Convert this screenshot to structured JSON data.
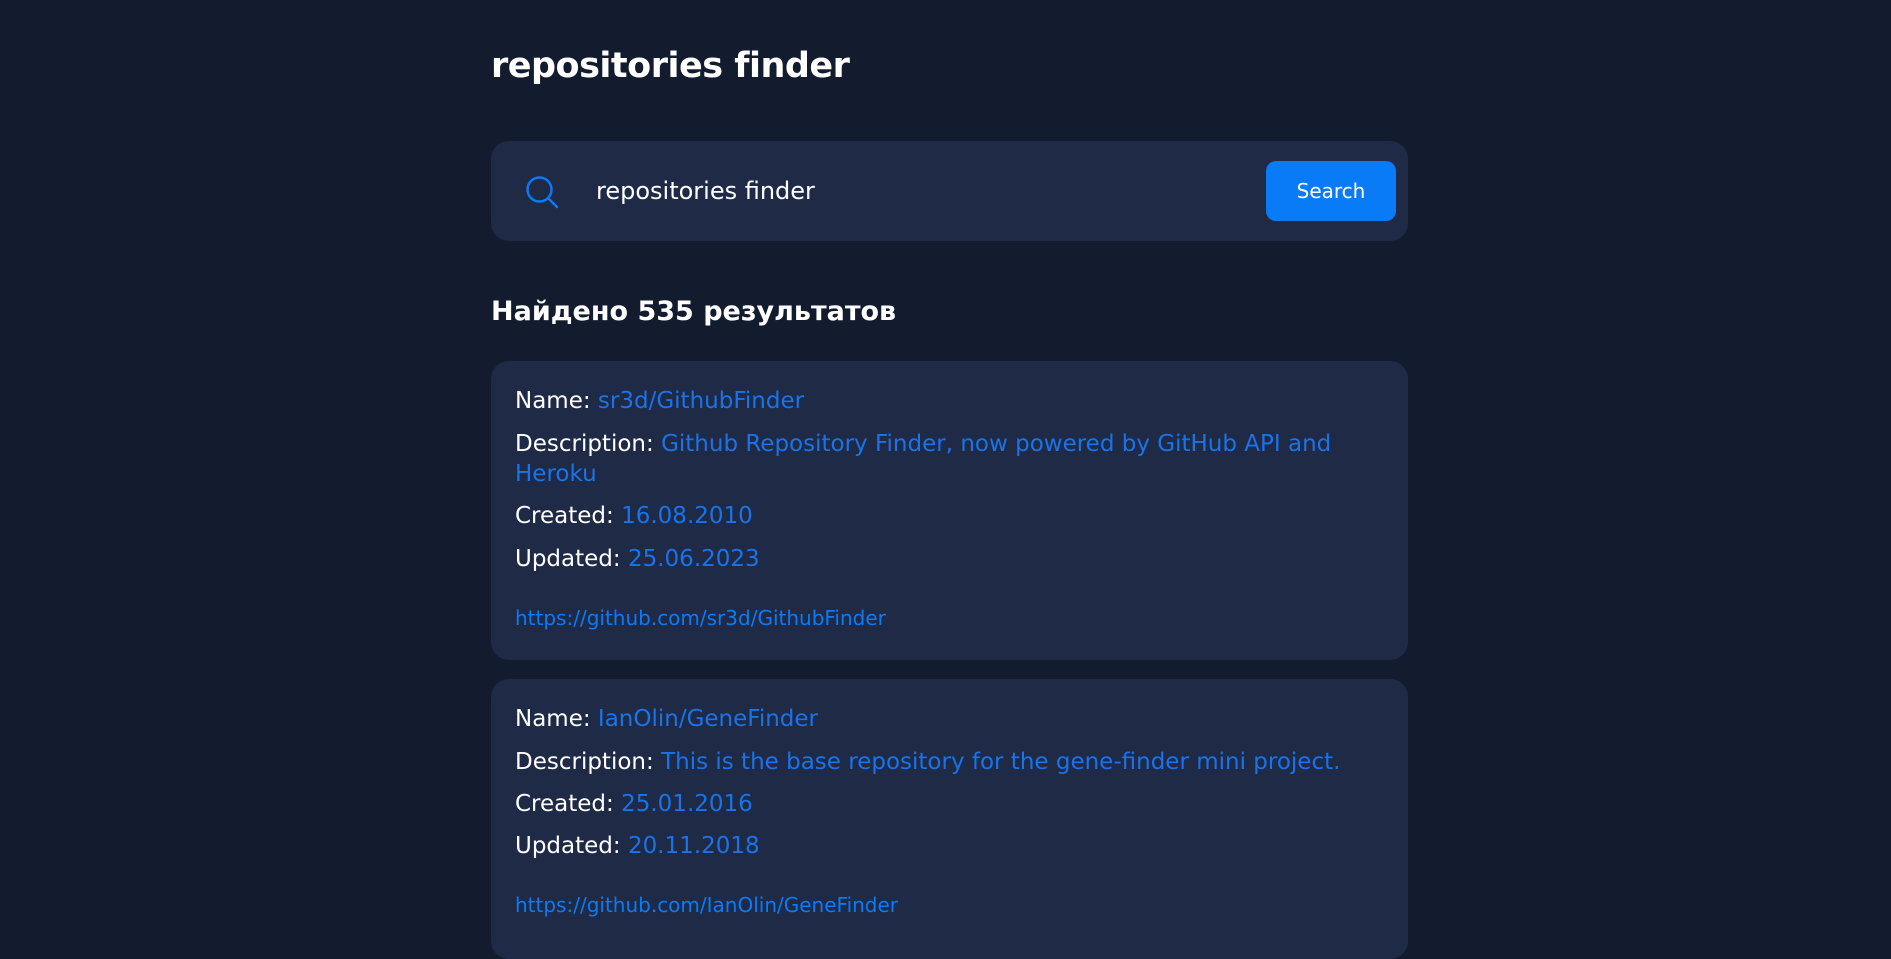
{
  "app": {
    "title": "repositories finder"
  },
  "search": {
    "value": "repositories finder",
    "button_label": "Search"
  },
  "results": {
    "count_text": "Найдено 535 результатов"
  },
  "labels": {
    "name": "Name:",
    "description": "Description:",
    "created": "Created:",
    "updated": "Updated:"
  },
  "repos": [
    {
      "name": "sr3d/GithubFinder",
      "description": "Github Repository Finder, now powered by GitHub API and Heroku",
      "created": "16.08.2010",
      "updated": "25.06.2023",
      "url": "https://github.com/sr3d/GithubFinder"
    },
    {
      "name": "IanOlin/GeneFinder",
      "description": "This is the base repository for the gene-finder mini project.",
      "created": "25.01.2016",
      "updated": "20.11.2018",
      "url": "https://github.com/IanOlin/GeneFinder"
    }
  ],
  "colors": {
    "background": "#131c2e",
    "panel": "#1f2a47",
    "accent": "#0a7bf7",
    "value_text": "#1a73e8"
  }
}
